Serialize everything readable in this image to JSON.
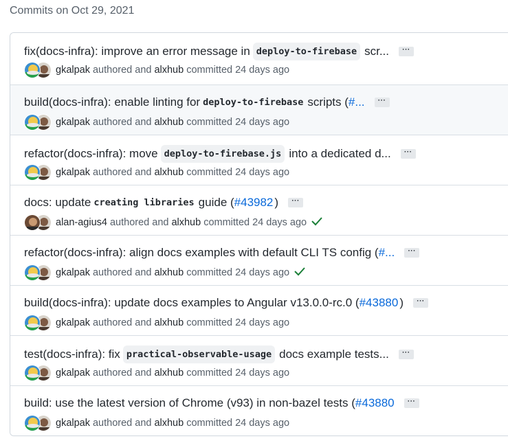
{
  "group_title": "Commits on Oct 29, 2021",
  "colors": {
    "link": "#0969da",
    "success": "#1a7f37",
    "muted": "#57606a"
  },
  "commits": [
    {
      "parts": [
        {
          "t": "text",
          "v": "fix(docs-infra): improve an error message in"
        },
        {
          "t": "code",
          "v": "deploy-to-firebase"
        },
        {
          "t": "text",
          "v": "scr..."
        }
      ],
      "author": "gkalpak",
      "committer": "alxhub",
      "time": "24 days ago",
      "verified": false,
      "avatar": "gkalpak"
    },
    {
      "parts": [
        {
          "t": "text",
          "v": "build(docs-infra): enable linting for"
        },
        {
          "t": "plaincode",
          "v": "deploy-to-firebase"
        },
        {
          "t": "text",
          "v": "scripts ("
        },
        {
          "t": "link",
          "v": "#..."
        }
      ],
      "author": "gkalpak",
      "committer": "alxhub",
      "time": "24 days ago",
      "verified": false,
      "avatar": "gkalpak"
    },
    {
      "parts": [
        {
          "t": "text",
          "v": "refactor(docs-infra): move"
        },
        {
          "t": "code",
          "v": "deploy-to-firebase.js"
        },
        {
          "t": "text",
          "v": "into a dedicated d..."
        }
      ],
      "author": "gkalpak",
      "committer": "alxhub",
      "time": "24 days ago",
      "verified": false,
      "avatar": "gkalpak"
    },
    {
      "parts": [
        {
          "t": "text",
          "v": "docs: update"
        },
        {
          "t": "plaincode",
          "v": "creating libraries"
        },
        {
          "t": "text",
          "v": "guide ("
        },
        {
          "t": "link",
          "v": "#43982"
        },
        {
          "t": "text",
          "v": ")"
        }
      ],
      "author": "alan-agius4",
      "committer": "alxhub",
      "time": "24 days ago",
      "verified": true,
      "avatar": "alan"
    },
    {
      "parts": [
        {
          "t": "text",
          "v": "refactor(docs-infra): align docs examples with default CLI TS config ("
        },
        {
          "t": "link",
          "v": "#..."
        }
      ],
      "author": "gkalpak",
      "committer": "alxhub",
      "time": "24 days ago",
      "verified": true,
      "avatar": "gkalpak"
    },
    {
      "parts": [
        {
          "t": "text",
          "v": "build(docs-infra): update docs examples to Angular v13.0.0-rc.0 ("
        },
        {
          "t": "link",
          "v": "#43880"
        },
        {
          "t": "text",
          "v": ")"
        }
      ],
      "author": "gkalpak",
      "committer": "alxhub",
      "time": "24 days ago",
      "verified": false,
      "avatar": "gkalpak"
    },
    {
      "parts": [
        {
          "t": "text",
          "v": "test(docs-infra): fix"
        },
        {
          "t": "code",
          "v": "practical-observable-usage"
        },
        {
          "t": "text",
          "v": "docs example tests..."
        }
      ],
      "author": "gkalpak",
      "committer": "alxhub",
      "time": "24 days ago",
      "verified": false,
      "avatar": "gkalpak"
    },
    {
      "parts": [
        {
          "t": "text",
          "v": "build: use the latest version of Chrome (v93) in non-bazel tests ("
        },
        {
          "t": "link",
          "v": "#43880"
        }
      ],
      "author": "gkalpak",
      "committer": "alxhub",
      "time": "24 days ago",
      "verified": false,
      "avatar": "gkalpak"
    }
  ],
  "labels": {
    "authored": "authored and",
    "committed": "committed",
    "more": "···"
  }
}
